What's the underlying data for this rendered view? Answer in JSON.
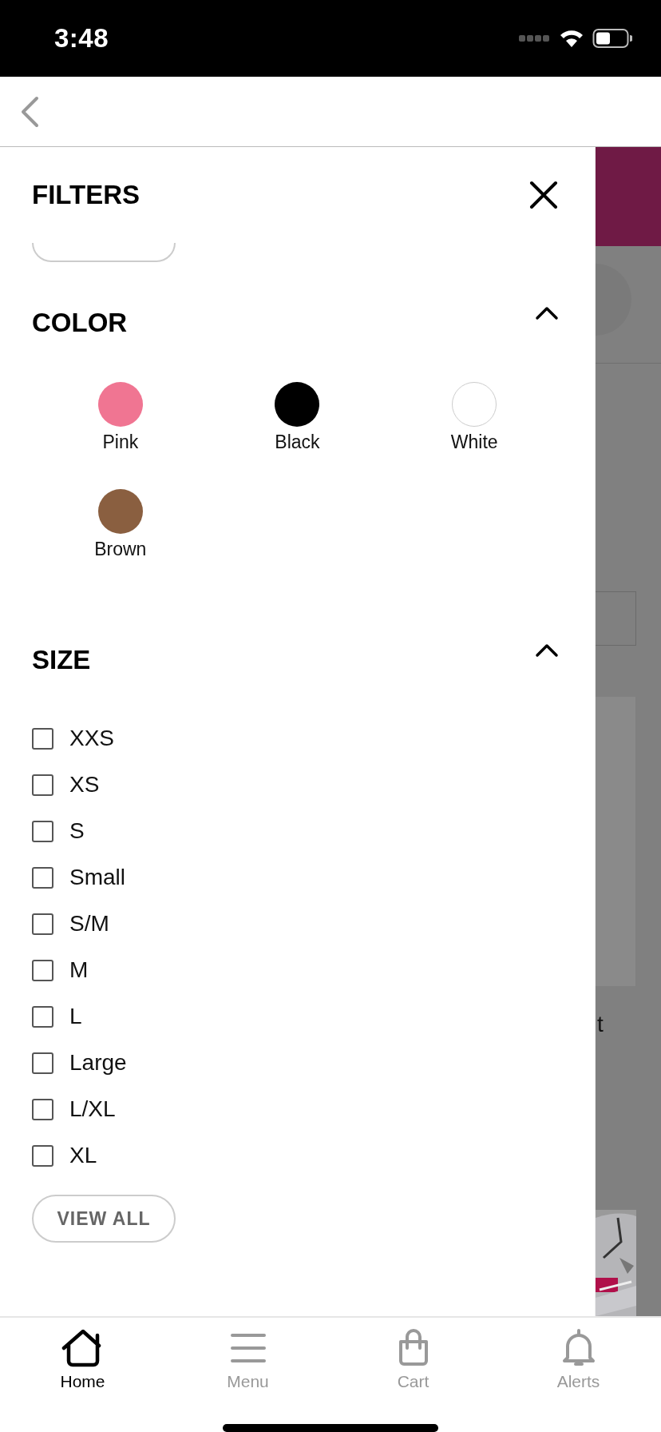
{
  "status_bar": {
    "time": "3:48"
  },
  "filters": {
    "title": "FILTERS",
    "color_section": {
      "title": "COLOR",
      "expanded": true,
      "options": [
        {
          "name": "Pink",
          "color": "#f07592"
        },
        {
          "name": "Black",
          "color": "#000000"
        },
        {
          "name": "White",
          "color": "#ffffff"
        },
        {
          "name": "Brown",
          "color": "#8a5f40"
        }
      ]
    },
    "size_section": {
      "title": "SIZE",
      "expanded": true,
      "options": [
        {
          "label": "XXS",
          "checked": false
        },
        {
          "label": "XS",
          "checked": false
        },
        {
          "label": "S",
          "checked": false
        },
        {
          "label": "Small",
          "checked": false
        },
        {
          "label": "S/M",
          "checked": false
        },
        {
          "label": "M",
          "checked": false
        },
        {
          "label": "L",
          "checked": false
        },
        {
          "label": "Large",
          "checked": false
        },
        {
          "label": "L/XL",
          "checked": false
        },
        {
          "label": "XL",
          "checked": false
        }
      ],
      "button": "VIEW ALL"
    }
  },
  "background_page": {
    "text": "t"
  },
  "tab_bar": [
    {
      "kind": "home",
      "label": "Home",
      "selected": true
    },
    {
      "kind": "menu",
      "label": "Menu",
      "selected": false
    },
    {
      "kind": "cart",
      "label": "Cart",
      "selected": false
    },
    {
      "kind": "alerts",
      "label": "Alerts",
      "selected": false
    }
  ]
}
